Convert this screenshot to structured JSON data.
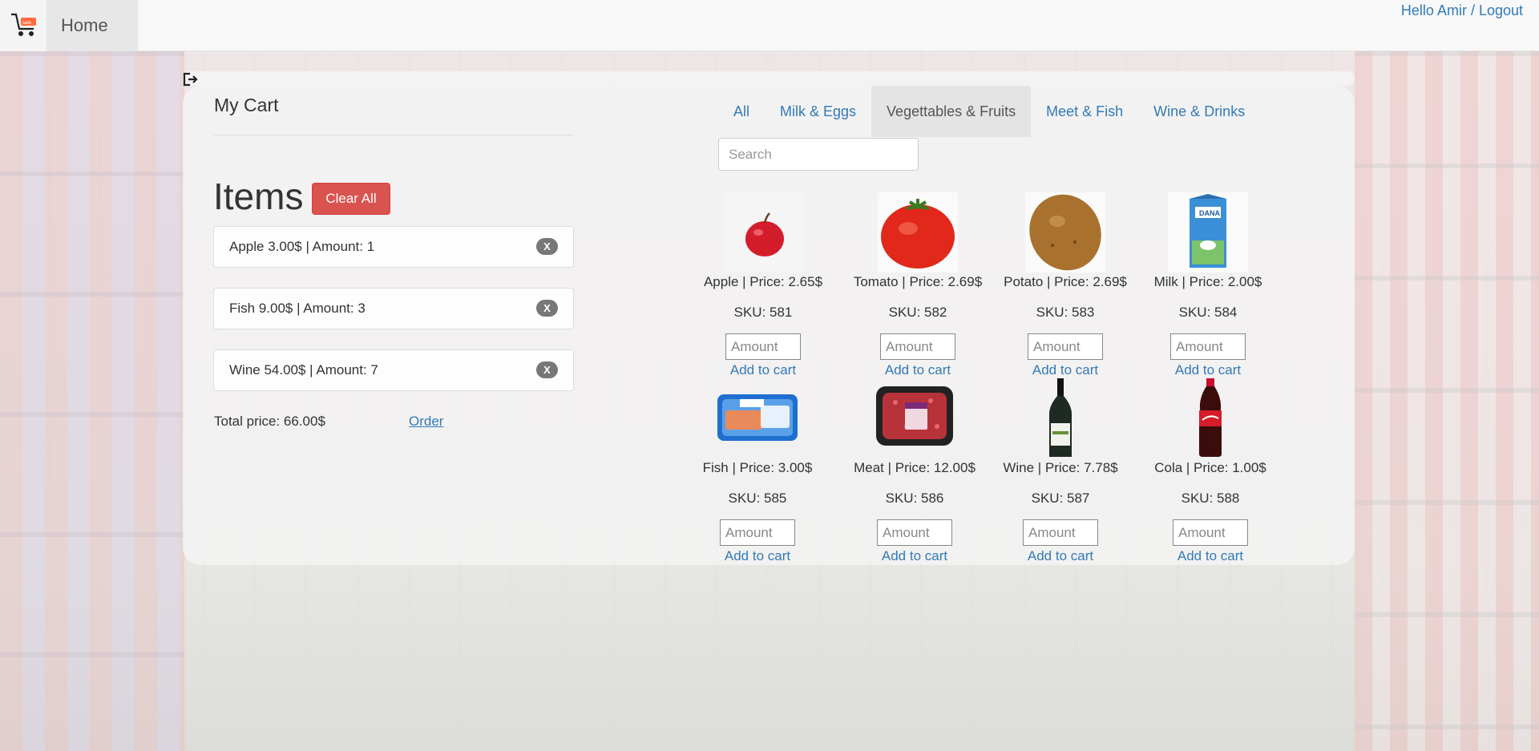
{
  "navbar": {
    "brand_icon": "shopping-cart-icon",
    "home_label": "Home",
    "user_text": "Hello Amir / Logout"
  },
  "cart": {
    "title": "My Cart",
    "items_heading": "Items",
    "clear_all_label": "Clear All",
    "items": [
      {
        "text": "Apple 3.00$ | Amount: 1",
        "remove_label": "X"
      },
      {
        "text": "Fish 9.00$ | Amount: 3",
        "remove_label": "X"
      },
      {
        "text": "Wine 54.00$ | Amount: 7",
        "remove_label": "X"
      }
    ],
    "total_text": "Total price: 66.00$",
    "order_label": "Order"
  },
  "tabs": [
    {
      "label": "All",
      "active": false
    },
    {
      "label": "Milk & Eggs",
      "active": false
    },
    {
      "label": "Vegettables & Fruits",
      "active": true
    },
    {
      "label": "Meet & Fish",
      "active": false
    },
    {
      "label": "Wine & Drinks",
      "active": false
    }
  ],
  "search": {
    "placeholder": "Search"
  },
  "products": [
    {
      "name": "Apple | Price: 2.65$",
      "sku": "SKU: 581",
      "amount_placeholder": "Amount",
      "add_label": "Add to cart"
    },
    {
      "name": "Tomato | Price: 2.69$",
      "sku": "SKU: 582",
      "amount_placeholder": "Amount",
      "add_label": "Add to cart"
    },
    {
      "name": "Potato | Price: 2.69$",
      "sku": "SKU: 583",
      "amount_placeholder": "Amount",
      "add_label": "Add to cart"
    },
    {
      "name": "Milk | Price: 2.00$",
      "sku": "SKU: 584",
      "amount_placeholder": "Amount",
      "add_label": "Add to cart"
    },
    {
      "name": "Fish | Price: 3.00$",
      "sku": "SKU: 585",
      "amount_placeholder": "Amount",
      "add_label": "Add to cart"
    },
    {
      "name": "Meat | Price: 12.00$",
      "sku": "SKU: 586",
      "amount_placeholder": "Amount",
      "add_label": "Add to cart"
    },
    {
      "name": "Wine | Price: 7.78$",
      "sku": "SKU: 587",
      "amount_placeholder": "Amount",
      "add_label": "Add to cart"
    },
    {
      "name": "Cola | Price: 1.00$",
      "sku": "SKU: 588",
      "amount_placeholder": "Amount",
      "add_label": "Add to cart"
    }
  ],
  "colors": {
    "accent": "#337ab7",
    "danger": "#d9534f",
    "badge": "#777777"
  }
}
